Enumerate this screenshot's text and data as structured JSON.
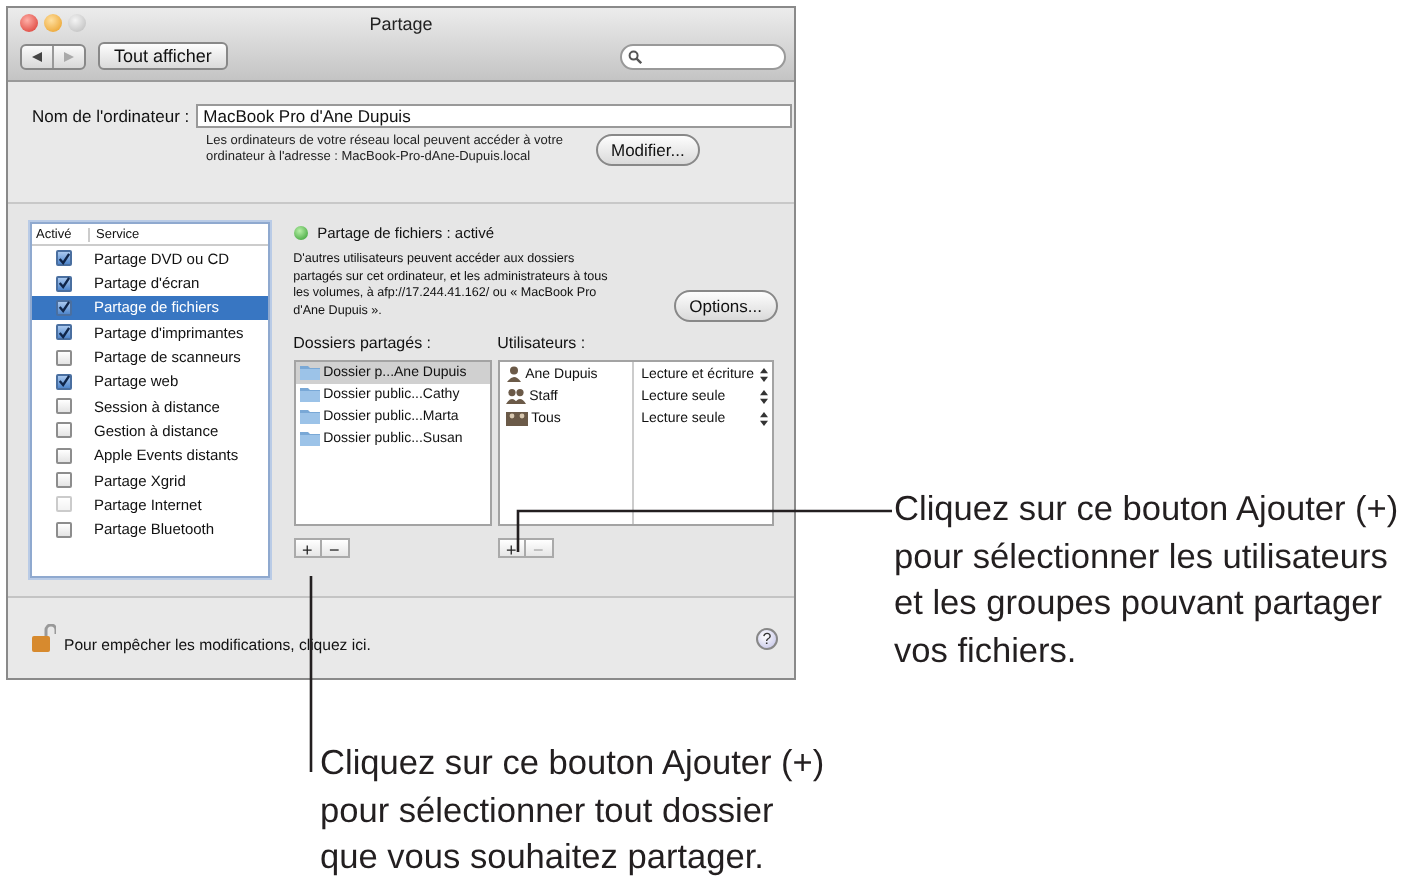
{
  "window": {
    "title": "Partage"
  },
  "toolbar": {
    "show_all": "Tout afficher"
  },
  "computer_name": {
    "label": "Nom de l'ordinateur :",
    "value": "MacBook Pro d'Ane Dupuis",
    "note": [
      "Les ordinateurs de votre réseau local peuvent accéder à votre",
      "ordinateur à l'adresse : MacBook-Pro-dAne-Dupuis.local"
    ],
    "button": "Modifier..."
  },
  "services": {
    "columns": [
      "Activé",
      "Service"
    ],
    "items": [
      {
        "label": "Partage DVD ou CD",
        "checked": true,
        "selected": false,
        "disabled": false
      },
      {
        "label": "Partage d'écran",
        "checked": true,
        "selected": false,
        "disabled": false
      },
      {
        "label": "Partage de fichiers",
        "checked": true,
        "selected": true,
        "disabled": false
      },
      {
        "label": "Partage d'imprimantes",
        "checked": true,
        "selected": false,
        "disabled": false
      },
      {
        "label": "Partage de scanneurs",
        "checked": false,
        "selected": false,
        "disabled": false
      },
      {
        "label": "Partage web",
        "checked": true,
        "selected": false,
        "disabled": false
      },
      {
        "label": "Session à distance",
        "checked": false,
        "selected": false,
        "disabled": false
      },
      {
        "label": "Gestion à distance",
        "checked": false,
        "selected": false,
        "disabled": false
      },
      {
        "label": "Apple Events distants",
        "checked": false,
        "selected": false,
        "disabled": false
      },
      {
        "label": "Partage Xgrid",
        "checked": false,
        "selected": false,
        "disabled": false
      },
      {
        "label": "Partage Internet",
        "checked": false,
        "selected": false,
        "disabled": true
      },
      {
        "label": "Partage Bluetooth",
        "checked": false,
        "selected": false,
        "disabled": false
      }
    ]
  },
  "status": {
    "title": "Partage de fichiers : activé",
    "on": true,
    "description": [
      "D'autres utilisateurs peuvent accéder aux dossiers",
      "partagés sur cet ordinateur, et les administrateurs à tous",
      "les volumes, à afp://17.244.41.162/ ou « MacBook Pro",
      "d'Ane Dupuis »."
    ],
    "button": "Options..."
  },
  "shared_folders": {
    "label": "Dossiers partagés :",
    "items": [
      {
        "name": "Dossier p...Ane Dupuis",
        "selected": true
      },
      {
        "name": "Dossier public...Cathy",
        "selected": false
      },
      {
        "name": "Dossier public...Marta",
        "selected": false
      },
      {
        "name": "Dossier public...Susan",
        "selected": false
      }
    ],
    "add": "+",
    "remove": "−",
    "remove_disabled": false
  },
  "users": {
    "label": "Utilisateurs :",
    "items": [
      {
        "name": "Ane Dupuis",
        "kind": "user",
        "permission": "Lecture et écriture"
      },
      {
        "name": "Staff",
        "kind": "group",
        "permission": "Lecture seule"
      },
      {
        "name": "Tous",
        "kind": "everyone",
        "permission": "Lecture seule"
      }
    ],
    "add": "+",
    "remove": "−",
    "remove_disabled": true
  },
  "lock": {
    "text": "Pour empêcher les modifications, cliquez ici.",
    "locked": false
  },
  "help": "?",
  "callouts": [
    {
      "kind": "users",
      "lines": [
        "Cliquez sur ce bouton Ajouter (+)",
        "pour sélectionner les utilisateurs",
        "et les groupes pouvant partager",
        "vos fichiers."
      ]
    },
    {
      "kind": "folders",
      "lines": [
        "Cliquez sur ce bouton Ajouter (+)",
        "pour sélectionner tout dossier",
        "que vous souhaitez partager."
      ]
    }
  ]
}
